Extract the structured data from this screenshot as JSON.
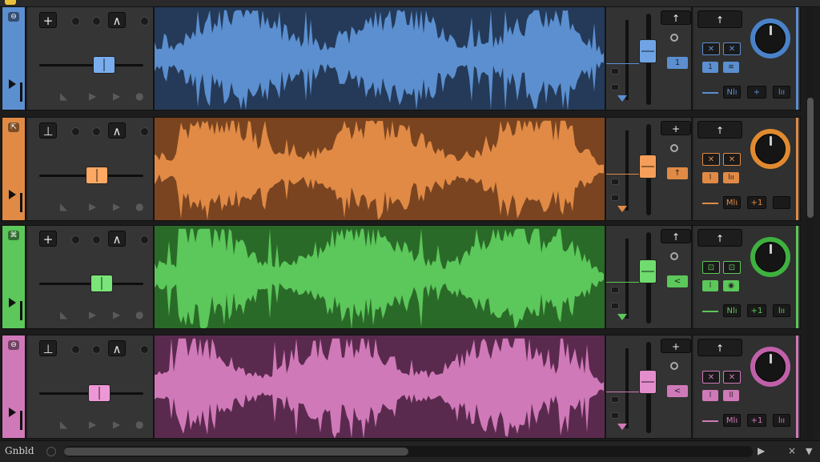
{
  "window": {
    "bottom_label": "Gnbld",
    "play_glyph": "▶",
    "close_glyph": "×",
    "scroll_down_glyph": "▼"
  },
  "tracks": [
    {
      "id": "blue",
      "color": "#5b8fd0",
      "wave_bg": "#243a58",
      "strip_icon": "⊖",
      "buttons": [
        "+",
        "•",
        "•",
        "∧",
        "•"
      ],
      "foot_icons": [
        "◣",
        "▶",
        "▶",
        "●"
      ],
      "fader_level": 0.62,
      "meter_button": "↑",
      "meter_tag": "1",
      "fx_top": "↑",
      "fx_chips": [
        "✕",
        "✕",
        "1",
        "≋"
      ],
      "fx_small": [
        "Nlı",
        "+",
        "lıı"
      ],
      "knob_ring": "#4a82c8"
    },
    {
      "id": "orange",
      "color": "#e08a45",
      "wave_bg": "#7a4420",
      "strip_icon": "⇱",
      "buttons": [
        "⊥",
        "•",
        "•",
        "∧",
        "•"
      ],
      "foot_icons": [
        "◣",
        "▶",
        "▶",
        "●"
      ],
      "fader_level": 0.55,
      "meter_button": "+",
      "meter_tag": "↑",
      "fx_top": "↑",
      "fx_chips": [
        "✕",
        "✕",
        "l",
        "lıı"
      ],
      "fx_small": [
        "Mlı",
        "+1",
        ""
      ],
      "knob_ring": "#e08a30"
    },
    {
      "id": "green",
      "color": "#5cc75a",
      "wave_bg": "#2a6a28",
      "strip_icon": "⌘",
      "buttons": [
        "+",
        "•",
        "•",
        "∧",
        "•"
      ],
      "foot_icons": [
        "◣",
        "▶",
        "▶",
        "●"
      ],
      "fader_level": 0.6,
      "meter_button": "↑",
      "meter_tag": "<",
      "fx_top": "↑",
      "fx_chips": [
        "⊡",
        "⊡",
        "l",
        "◉"
      ],
      "fx_small": [
        "Nlı",
        "+1",
        "lıı"
      ],
      "knob_ring": "#3fb040"
    },
    {
      "id": "pink",
      "color": "#d079b8",
      "wave_bg": "#5a2a4e",
      "strip_icon": "⊖",
      "buttons": [
        "⊥",
        "•",
        "•",
        "∧",
        "•"
      ],
      "foot_icons": [
        "◣",
        "▶",
        "▶",
        "●"
      ],
      "fader_level": 0.58,
      "meter_button": "+",
      "meter_tag": "<",
      "fx_top": "↑",
      "fx_chips": [
        "✕",
        "✕",
        "l",
        "ll"
      ],
      "fx_small": [
        "Mlı",
        "+1",
        "lıı"
      ],
      "knob_ring": "#c060a8"
    }
  ]
}
